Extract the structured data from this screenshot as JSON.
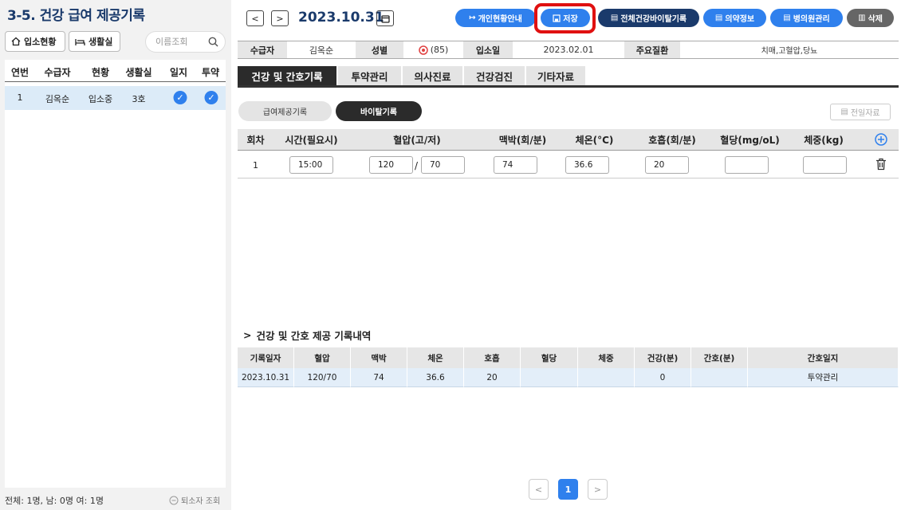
{
  "left": {
    "title": "3-5. 건강 급여 제공기록",
    "btn_admission": "입소현황",
    "btn_room": "생활실",
    "search_placeholder": "이름조회",
    "headers": [
      "연번",
      "수급자",
      "현황",
      "생활실",
      "일지",
      "투약"
    ],
    "rows": [
      {
        "no": "1",
        "name": "김옥순",
        "status": "입소중",
        "room": "3호",
        "journal": true,
        "medication": true
      }
    ],
    "footer": "전체: 1명,  남: 0명  여: 1명",
    "discharged_link": "퇴소자 조회"
  },
  "header": {
    "date": "2023.10.31",
    "buttons": {
      "personal": "개인현황안내",
      "save": "저장",
      "vital_all": "전체건강바이탈기록",
      "medication": "의약정보",
      "hospital": "병의원관리",
      "delete": "삭제"
    },
    "colors": {
      "blue": "#2f80ed",
      "navy": "#1a3a6b",
      "highlight": "#e01010"
    }
  },
  "info": {
    "recipient_label": "수급자",
    "recipient": "김옥순",
    "gender_label": "성별",
    "gender_value": "(85)",
    "admission_label": "입소일",
    "admission_date": "2023.02.01",
    "disease_label": "주요질환",
    "disease": "치매,고혈압,당뇨"
  },
  "tabs": [
    "건강 및 간호기록",
    "투약관리",
    "의사진료",
    "건강검진",
    "기타자료"
  ],
  "subtabs": {
    "benefit": "급여제공기록",
    "vital": "바이탈기록",
    "prev": "전일자료"
  },
  "vital": {
    "headers": [
      "회차",
      "시간(필요시)",
      "혈압(고/저)",
      "맥박(회/분)",
      "체온(°C)",
      "호흡(회/분)",
      "혈당(mg/oL)",
      "체중(kg)"
    ],
    "row": {
      "round": "1",
      "time": "15:00",
      "bp_high": "120",
      "bp_sep": "/",
      "bp_low": "70",
      "pulse": "74",
      "temp": "36.6",
      "resp": "20",
      "sugar": "",
      "weight": ""
    }
  },
  "history": {
    "title": "건강 및 간호 제공 기록내역",
    "headers": [
      "기록일자",
      "혈압",
      "맥박",
      "체온",
      "호흡",
      "혈당",
      "체중",
      "건강(분)",
      "간호(분)",
      "간호일지"
    ],
    "rows": [
      [
        "2023.10.31",
        "120/70",
        "74",
        "36.6",
        "20",
        "",
        "",
        "0",
        "",
        "투약관리"
      ]
    ]
  },
  "pagination": {
    "current": "1"
  }
}
